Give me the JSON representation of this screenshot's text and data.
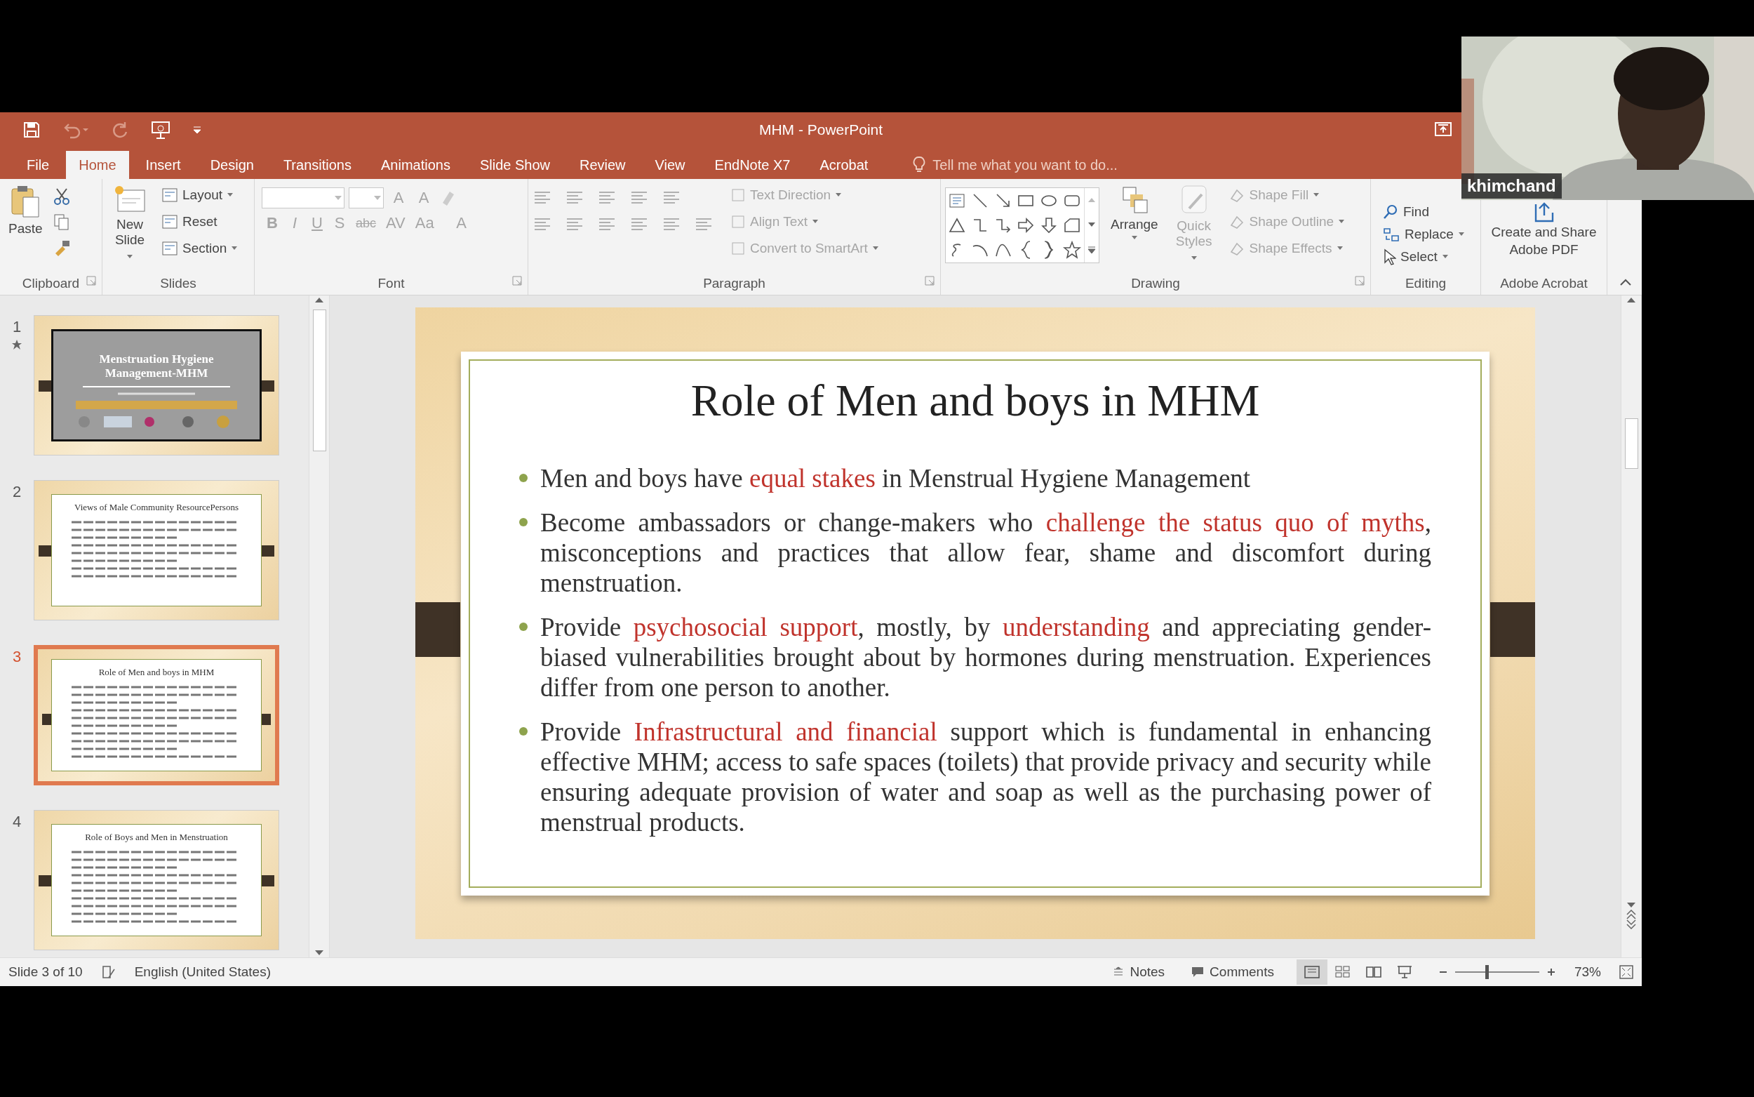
{
  "window": {
    "title": "MHM - PowerPoint"
  },
  "menu_tabs": [
    {
      "label": "File",
      "selected": false
    },
    {
      "label": "Home",
      "selected": true
    },
    {
      "label": "Insert",
      "selected": false
    },
    {
      "label": "Design",
      "selected": false
    },
    {
      "label": "Transitions",
      "selected": false
    },
    {
      "label": "Animations",
      "selected": false
    },
    {
      "label": "Slide Show",
      "selected": false
    },
    {
      "label": "Review",
      "selected": false
    },
    {
      "label": "View",
      "selected": false
    },
    {
      "label": "EndNote X7",
      "selected": false
    },
    {
      "label": "Acrobat",
      "selected": false
    }
  ],
  "tell_me": {
    "placeholder": "Tell me what you want to do..."
  },
  "ribbon": [
    {
      "kind": "clipboard",
      "label": "Clipboard",
      "buttons": [
        {
          "label": "Paste",
          "disabled": false
        }
      ]
    },
    {
      "kind": "slides",
      "label": "Slides",
      "buttons": [
        {
          "label": "New Slide",
          "disabled": false
        },
        {
          "label": "Layout",
          "disabled": false
        },
        {
          "label": "Reset",
          "disabled": false
        },
        {
          "label": "Section",
          "disabled": false
        }
      ]
    },
    {
      "kind": "font",
      "label": "Font",
      "buttons": [
        {
          "label": "A",
          "kind": "grow",
          "disabled": true
        },
        {
          "label": "A",
          "kind": "shrink",
          "disabled": true
        },
        {
          "label": "B",
          "kind": "bold",
          "disabled": true
        },
        {
          "label": "I",
          "kind": "italic",
          "disabled": true
        },
        {
          "label": "U",
          "kind": "underline",
          "disabled": true
        },
        {
          "label": "S",
          "kind": "shadow",
          "disabled": true
        },
        {
          "label": "abc",
          "kind": "strike",
          "disabled": true
        },
        {
          "label": "AV",
          "kind": "spacing",
          "disabled": true
        },
        {
          "label": "Aa",
          "kind": "case",
          "disabled": true
        },
        {
          "label": "A",
          "kind": "color",
          "disabled": true
        }
      ]
    },
    {
      "kind": "paragraph",
      "label": "Paragraph",
      "buttons": [
        {
          "label": "Text Direction",
          "disabled": true
        },
        {
          "label": "Align Text",
          "disabled": true
        },
        {
          "label": "Convert to SmartArt",
          "disabled": true
        }
      ]
    },
    {
      "kind": "drawing",
      "label": "Drawing",
      "buttons": [
        {
          "label": "Arrange",
          "disabled": false
        },
        {
          "label": "Quick Styles",
          "disabled": true
        },
        {
          "label": "Shape Fill",
          "disabled": true
        },
        {
          "label": "Shape Outline",
          "disabled": true
        },
        {
          "label": "Shape Effects",
          "disabled": true
        }
      ]
    },
    {
      "kind": "editing",
      "label": "Editing",
      "buttons": [
        {
          "label": "Find",
          "disabled": false
        },
        {
          "label": "Replace",
          "disabled": false
        },
        {
          "label": "Select",
          "disabled": false
        }
      ]
    },
    {
      "kind": "acrobat",
      "label": "Adobe Acrobat",
      "buttons": [
        {
          "label": "Create and Share Adobe PDF",
          "disabled": false
        }
      ]
    }
  ],
  "slides_pane": [
    {
      "number": "1",
      "title": "Menstruation Hygiene Management-MHM",
      "kind": "cover",
      "animated": true,
      "selected": false
    },
    {
      "number": "2",
      "title": "Views of Male Community ResourcePersons",
      "kind": "content",
      "animated": false,
      "selected": false
    },
    {
      "number": "3",
      "title": "Role of Men and boys in MHM",
      "kind": "content",
      "animated": false,
      "selected": true
    },
    {
      "number": "4",
      "title": "Role of Boys and Men in Menstruation",
      "kind": "content",
      "animated": false,
      "selected": false
    }
  ],
  "slide": {
    "title": "Role of Men and boys in MHM",
    "bullets": [
      {
        "segments": [
          {
            "text": "Men and boys have ",
            "highlight": false
          },
          {
            "text": "equal stakes",
            "highlight": true
          },
          {
            "text": " in Menstrual Hygiene Management",
            "highlight": false
          }
        ]
      },
      {
        "segments": [
          {
            "text": "Become ambassadors or change-makers who ",
            "highlight": false
          },
          {
            "text": "challenge the status quo of myths",
            "highlight": true
          },
          {
            "text": ", misconceptions and practices that allow fear, shame and discomfort during menstruation.",
            "highlight": false
          }
        ]
      },
      {
        "segments": [
          {
            "text": "Provide ",
            "highlight": false
          },
          {
            "text": "psychosocial support",
            "highlight": true
          },
          {
            "text": ", mostly, by ",
            "highlight": false
          },
          {
            "text": "understanding",
            "highlight": true
          },
          {
            "text": " and appreciating gender-biased vulnerabilities brought about by hormones during menstruation. Experiences differ from one person to another.",
            "highlight": false
          }
        ]
      },
      {
        "segments": [
          {
            "text": "Provide ",
            "highlight": false
          },
          {
            "text": "Infrastructural and financial",
            "highlight": true
          },
          {
            "text": " support which is fundamental in enhancing effective MHM; access to safe spaces (toilets) that provide privacy and security while ensuring adequate provision of water and soap as well as the purchasing power of menstrual products.",
            "highlight": false
          }
        ]
      }
    ]
  },
  "status_bar": {
    "slide_position": "Slide 3 of 10",
    "language": "English (United States)",
    "notes": "Notes",
    "comments": "Comments",
    "zoom": "73%",
    "level": 0.36
  },
  "webcam": {
    "name": "khimchand"
  }
}
